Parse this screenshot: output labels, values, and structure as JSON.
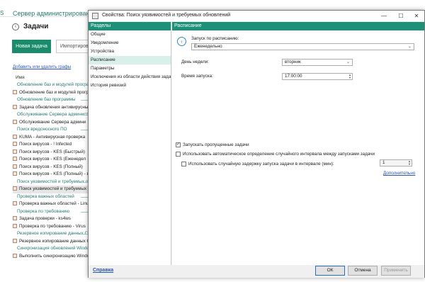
{
  "console": {
    "edge_letter": "S",
    "app_title": "Сервер администрирования К",
    "page_title": "Задачи",
    "new_task_button": "Новая задача",
    "import_button": "Импортирова",
    "groups_link": "Добавить или удалить графы",
    "column_name": "Имя",
    "rows": [
      {
        "type": "group",
        "text": "Обновление баз и модулей програ"
      },
      {
        "type": "task",
        "text": "Обновление баз и модулей прогр"
      },
      {
        "type": "group",
        "text": "Обновление баз программы"
      },
      {
        "type": "task",
        "text": "Задача обновления антивирусны"
      },
      {
        "type": "group",
        "text": "Обслуживание Сервера администр"
      },
      {
        "type": "task",
        "text": "Обслуживание Сервера админи"
      },
      {
        "type": "group",
        "text": "Поиск вредоносного ПО"
      },
      {
        "type": "task",
        "text": "KUMA - Антивирусная проверка"
      },
      {
        "type": "task",
        "text": "Поиск вирусов - ! Infected"
      },
      {
        "type": "task",
        "text": "Поиск вирусов - KES (Быстрый)"
      },
      {
        "type": "task",
        "text": "Поиск вирусов - KES (Еженедел"
      },
      {
        "type": "task",
        "text": "Поиск вирусов - KES (Полный)"
      },
      {
        "type": "task",
        "text": "Поиск вирусов - KES (Полный) - в"
      },
      {
        "type": "group",
        "text": "Поиск уязвимостей и требуемых о"
      },
      {
        "type": "task",
        "text": "Поиск уязвимостей и требуемых с",
        "selected": true
      },
      {
        "type": "group",
        "text": "Проверка важных областей"
      },
      {
        "type": "task",
        "text": "Проверка важных областей - Linu"
      },
      {
        "type": "group",
        "text": "Проверка по требованию"
      },
      {
        "type": "task",
        "text": "Задача проверки - ks4ws"
      },
      {
        "type": "task",
        "text": "Проверка по требованию - Virus"
      },
      {
        "type": "group",
        "text": "Резервное копирование данных Се"
      },
      {
        "type": "task",
        "text": "Резервное копирование данных С"
      },
      {
        "type": "group",
        "text": "Синхронизация обновлений Windo"
      },
      {
        "type": "task",
        "text": "Выполнить синхронизацию Windo"
      }
    ],
    "right_edge": [
      {
        "text": "ро",
        "y": "117"
      },
      {
        "text": "7%",
        "y": "186"
      },
      {
        "text": "т",
        "y": "330"
      },
      {
        "text": "т",
        "y": "354"
      },
      {
        "text": "т",
        "y": "378"
      }
    ]
  },
  "dialog": {
    "title": "Свойства: Поиск уязвимостей и требуемых обновлений",
    "window_buttons": {
      "minimize": "—",
      "maximize": "☐",
      "close": "✕"
    },
    "sections_header": "Разделы",
    "sections": [
      "Общие",
      "Уведомление",
      "Устройства",
      "Расписание",
      "Параметры",
      "Исключения из области действия задачи",
      "История ревизий"
    ],
    "active_section": "Расписание",
    "panel_header": "Расписание",
    "schedule_label": "Запуск по расписанию:",
    "schedule_value": "Еженедельно",
    "day_label": "День недели:",
    "day_value": "вторник",
    "time_label": "Время запуска:",
    "time_value": "17:00:00",
    "missed_label": "Запускать пропущенные задачи",
    "missed_checked": true,
    "auto_interval_label": "Использовать автоматическое определение случайного интервала между запусками задачи",
    "auto_interval_checked": false,
    "random_delay_label": "Использовать случайную задержку запуска задачи в интервале (мин):",
    "random_delay_checked": false,
    "random_delay_value": "1",
    "advanced_link": "Дополнительно",
    "help_link": "Справка",
    "ok_button": "ОК",
    "cancel_button": "Отмена",
    "apply_button": "Применить"
  }
}
